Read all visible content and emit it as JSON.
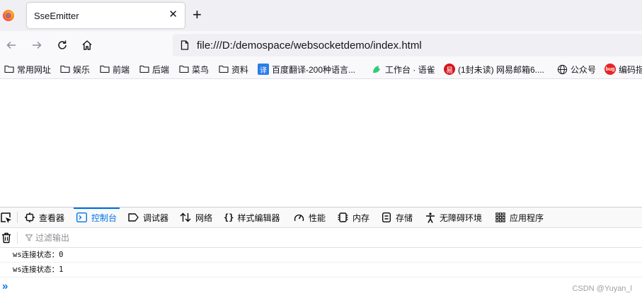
{
  "browser": {
    "tab_title": "SseEmitter",
    "url": "file:///D:/demospace/websocketdemo/index.html"
  },
  "bookmarks": [
    {
      "label": "常用网址",
      "icon": "folder-icon"
    },
    {
      "label": "娱乐",
      "icon": "folder-icon"
    },
    {
      "label": "前端",
      "icon": "folder-icon"
    },
    {
      "label": "后端",
      "icon": "folder-icon"
    },
    {
      "label": "菜鸟",
      "icon": "folder-icon"
    },
    {
      "label": "资料",
      "icon": "folder-icon"
    },
    {
      "label": "百度翻译-200种语言...",
      "icon": "baidu-translate-icon",
      "favicon_text": "译",
      "color": "#2b7de9"
    },
    {
      "label": "工作台 · 语雀",
      "icon": "yuque-icon",
      "color": "#31cc79"
    },
    {
      "label": "(1封未读) 网易邮箱6....",
      "icon": "netease-mail-icon",
      "favicon_text": "易",
      "color": "#d8131c"
    },
    {
      "label": "公众号",
      "icon": "globe-icon"
    },
    {
      "label": "编码指",
      "icon": "bug-icon",
      "favicon_text": "bug",
      "color": "#e62424"
    }
  ],
  "devtools": {
    "tabs": [
      {
        "label": "查看器",
        "icon": "inspector-icon"
      },
      {
        "label": "控制台",
        "icon": "console-icon",
        "selected": true
      },
      {
        "label": "调试器",
        "icon": "debugger-icon"
      },
      {
        "label": "网络",
        "icon": "network-icon"
      },
      {
        "label": "样式编辑器",
        "icon": "style-editor-icon"
      },
      {
        "label": "性能",
        "icon": "performance-icon"
      },
      {
        "label": "内存",
        "icon": "memory-icon"
      },
      {
        "label": "存储",
        "icon": "storage-icon"
      },
      {
        "label": "无障碍环境",
        "icon": "accessibility-icon"
      },
      {
        "label": "应用程序",
        "icon": "application-icon"
      }
    ],
    "filter_placeholder": "过滤输出",
    "console_lines": [
      "ws连接状态：0",
      "ws连接状态：1"
    ],
    "accent_color": "#0074e8"
  },
  "watermark": "CSDN @Yuyan_l"
}
